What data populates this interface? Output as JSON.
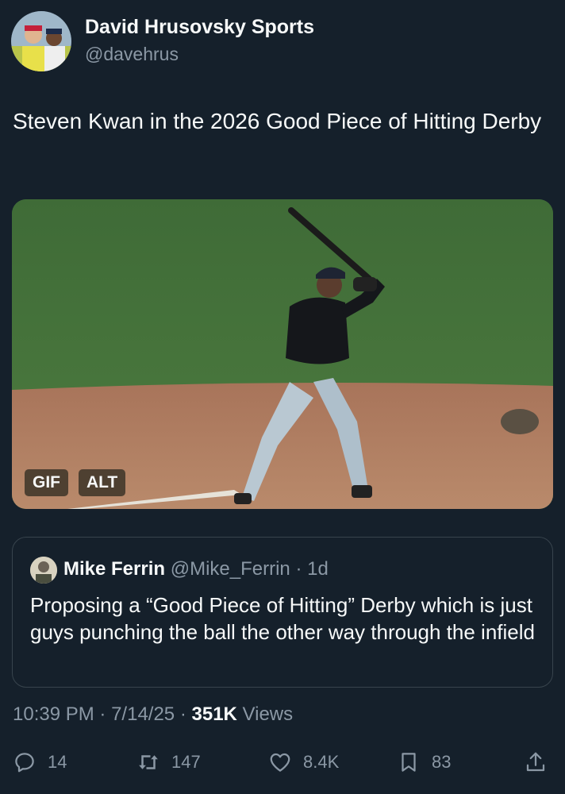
{
  "author": {
    "name": "David Hrusovsky Sports",
    "handle": "@davehrus"
  },
  "tweet": {
    "text": "Steven Kwan in the 2026 Good Piece of Hitting Derby"
  },
  "media": {
    "gif_badge": "GIF",
    "alt_badge": "ALT"
  },
  "quote": {
    "name": "Mike Ferrin",
    "handle": "@Mike_Ferrin",
    "separator": "·",
    "time": "1d",
    "text": "Proposing a “Good Piece of Hitting” Derby which is just guys punching the ball the other way through the infield"
  },
  "meta": {
    "time": "10:39 PM",
    "sep1": "·",
    "date": "7/14/25",
    "sep2": "·",
    "views_count": "351K",
    "views_label": "Views"
  },
  "actions": {
    "replies": "14",
    "retweets": "147",
    "likes": "8.4K",
    "bookmarks": "83"
  },
  "icons": {
    "reply": "reply-icon",
    "retweet": "retweet-icon",
    "like": "heart-icon",
    "bookmark": "bookmark-icon",
    "share": "share-icon"
  },
  "colors": {
    "background": "#15202b",
    "primary_text": "#f7f9f9",
    "secondary_text": "#8b98a5",
    "border": "#38444d"
  }
}
